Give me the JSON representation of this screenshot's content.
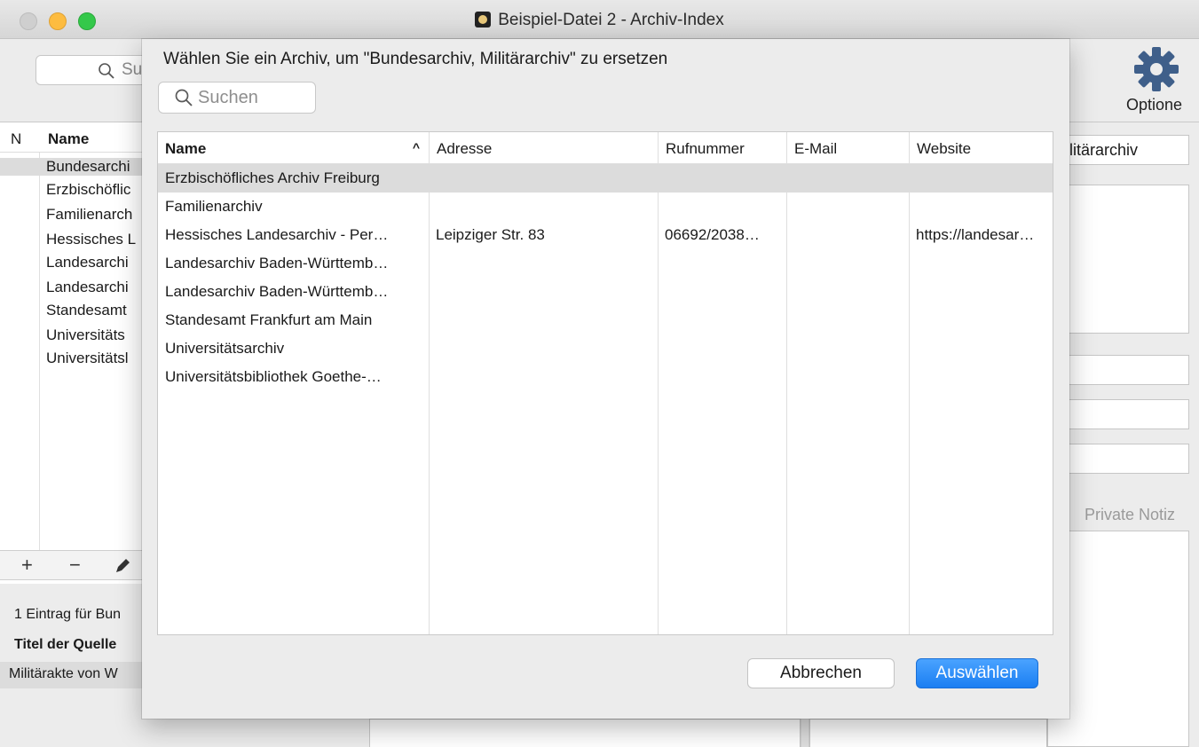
{
  "window": {
    "title": "Beispiel-Datei 2 - Archiv-Index"
  },
  "toolbar": {
    "search_fragment": "Su",
    "options_label": "Optione"
  },
  "left_list": {
    "col_n": "N",
    "col_name": "Name",
    "rows": [
      "Bundesarchi",
      "Erzbischöflic",
      "Familienarch",
      "Hessisches L",
      "Landesarchi",
      "Landesarchi",
      "Standesamt",
      "Universitäts",
      "Universitätsl"
    ],
    "actions": [
      "+",
      "−"
    ],
    "count_text": "1 Eintrag für Bun",
    "source_header": "Titel der Quelle",
    "source_row": "Militärakte von W"
  },
  "right_pane": {
    "name_field_value": "ilitärarchiv",
    "private_note_label": "Private Notiz"
  },
  "dialog": {
    "title": "Wählen Sie ein Archiv, um \"Bundesarchiv, Militärarchiv\" zu ersetzen",
    "search_placeholder": "Suchen",
    "columns": {
      "name": "Name",
      "address": "Adresse",
      "phone": "Rufnummer",
      "email": "E-Mail",
      "website": "Website"
    },
    "sort_indicator": "^",
    "rows": [
      {
        "name": "Erzbischöfliches Archiv Freiburg",
        "address": "",
        "phone": "",
        "email": "",
        "website": "",
        "selected": true
      },
      {
        "name": "Familienarchiv",
        "address": "",
        "phone": "",
        "email": "",
        "website": ""
      },
      {
        "name": "Hessisches Landesarchiv - Per…",
        "address": "Leipziger Str. 83",
        "phone": "06692/2038…",
        "email": "",
        "website": "https://landesar…"
      },
      {
        "name": "Landesarchiv Baden-Württemb…",
        "address": "",
        "phone": "",
        "email": "",
        "website": ""
      },
      {
        "name": "Landesarchiv Baden-Württemb…",
        "address": "",
        "phone": "",
        "email": "",
        "website": ""
      },
      {
        "name": "Standesamt Frankfurt am Main",
        "address": "",
        "phone": "",
        "email": "",
        "website": ""
      },
      {
        "name": "Universitätsarchiv",
        "address": "",
        "phone": "",
        "email": "",
        "website": ""
      },
      {
        "name": "Universitätsbibliothek Goethe-…",
        "address": "",
        "phone": "",
        "email": "",
        "website": ""
      }
    ],
    "cancel_label": "Abbrechen",
    "ok_label": "Auswählen"
  },
  "colors": {
    "accent": "#1b7ef2",
    "selection": "#dcdcdc"
  }
}
